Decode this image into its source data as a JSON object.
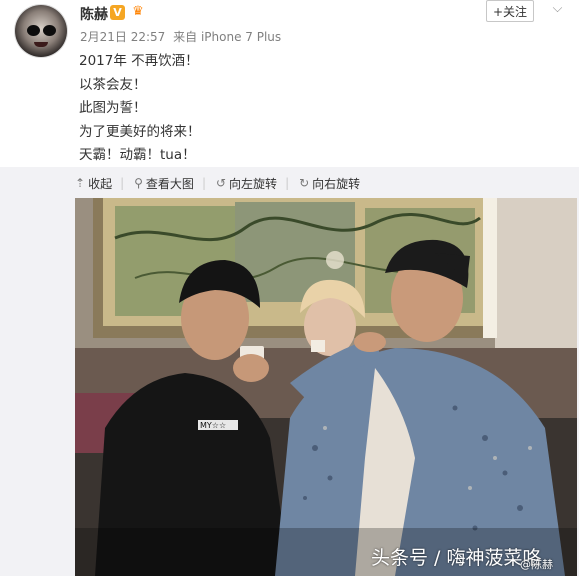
{
  "user": {
    "name": "陈赫",
    "verified_badge": "V",
    "follow_label": "+关注",
    "meta": {
      "date": "2月21日 22:57",
      "source": "来自 iPhone 7 Plus"
    }
  },
  "post": {
    "lines": [
      "2017年 不再饮酒！",
      "以茶会友！",
      "此图为誓！",
      "为了更美好的将来！",
      "天霸！动霸！tua！"
    ]
  },
  "toolbar": {
    "collapse_label": "收起",
    "view_large_label": "查看大图",
    "rotate_left_label": "向左旋转",
    "rotate_right_label": "向右旋转"
  },
  "photo": {
    "shirt_text": "MY☆☆",
    "watermark": "头条号 / 嗨神菠菜咯",
    "watermark_sub": "@陈赫"
  },
  "colors": {
    "accent": "#ff8200",
    "muted": "#808080",
    "verified": "#f5a623"
  }
}
